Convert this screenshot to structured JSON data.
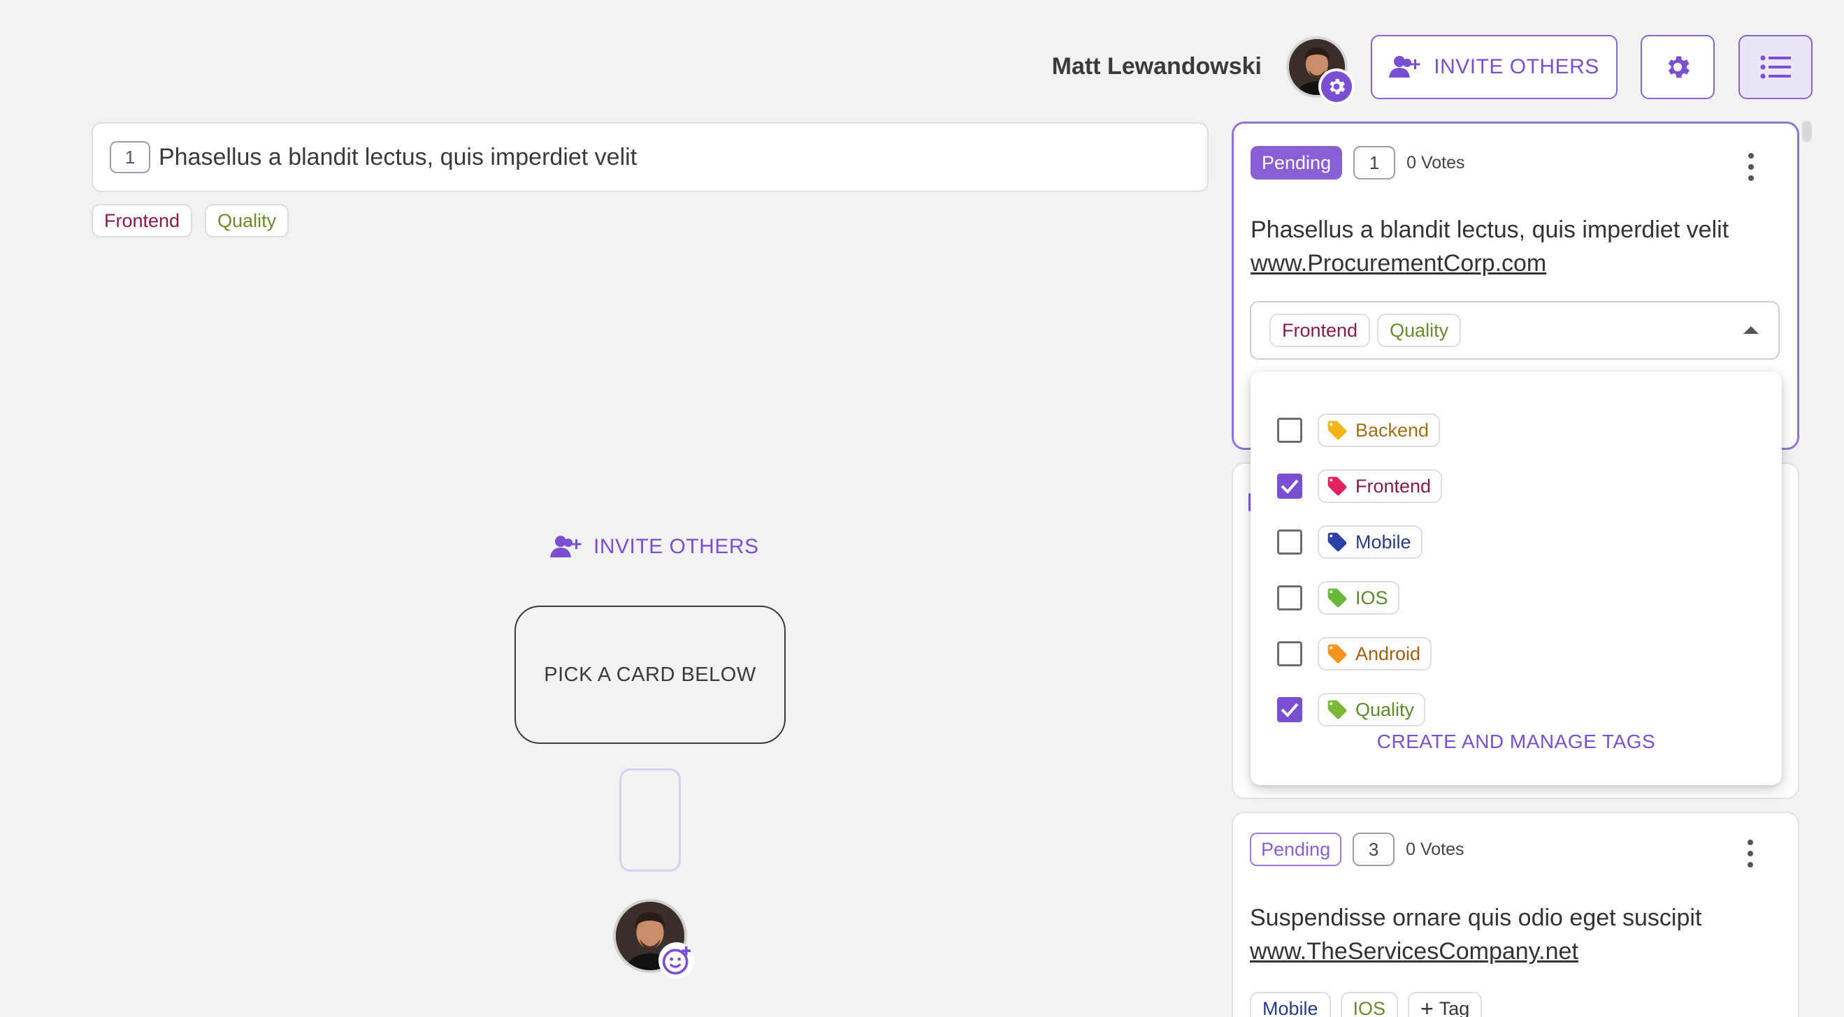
{
  "header": {
    "user_name": "Matt Lewandowski",
    "invite_label": "INVITE OTHERS"
  },
  "story": {
    "number": "1",
    "title": "Phasellus a blandit lectus, quis imperdiet velit",
    "tags": [
      "Frontend",
      "Quality"
    ]
  },
  "center": {
    "invite_label": "INVITE OTHERS",
    "pick_card_label": "PICK A CARD BELOW"
  },
  "cards": [
    {
      "status": "Pending",
      "number": "1",
      "votes": "0 Votes",
      "title": "Phasellus a blandit lectus, quis imperdiet velit",
      "link": "www.ProcurementCorp.com",
      "tags": [
        "Frontend",
        "Quality"
      ]
    },
    {
      "status": "Pending",
      "number": "3",
      "votes": "0 Votes",
      "title": "Suspendisse ornare quis odio eget suscipit",
      "link": "www.TheServicesCompany.net",
      "tags": [
        "Mobile",
        "IOS"
      ],
      "add_tag_label": "Tag"
    }
  ],
  "tag_dropdown": {
    "options": [
      {
        "label": "Backend",
        "checked": false,
        "color": "#f2b51c",
        "text_color": "#a07010"
      },
      {
        "label": "Frontend",
        "checked": true,
        "color": "#e2215e",
        "text_color": "#8a1a4a"
      },
      {
        "label": "Mobile",
        "checked": false,
        "color": "#2f3fa8",
        "text_color": "#273b80"
      },
      {
        "label": "IOS",
        "checked": false,
        "color": "#6ab83a",
        "text_color": "#5a8a2a"
      },
      {
        "label": "Android",
        "checked": false,
        "color": "#f7941d",
        "text_color": "#a06010"
      },
      {
        "label": "Quality",
        "checked": true,
        "color": "#7ab83a",
        "text_color": "#5a8a2a"
      }
    ],
    "footer_label": "CREATE AND MANAGE TAGS"
  },
  "colors": {
    "accent": "#7a4fd1",
    "background": "#f2f2f2"
  }
}
